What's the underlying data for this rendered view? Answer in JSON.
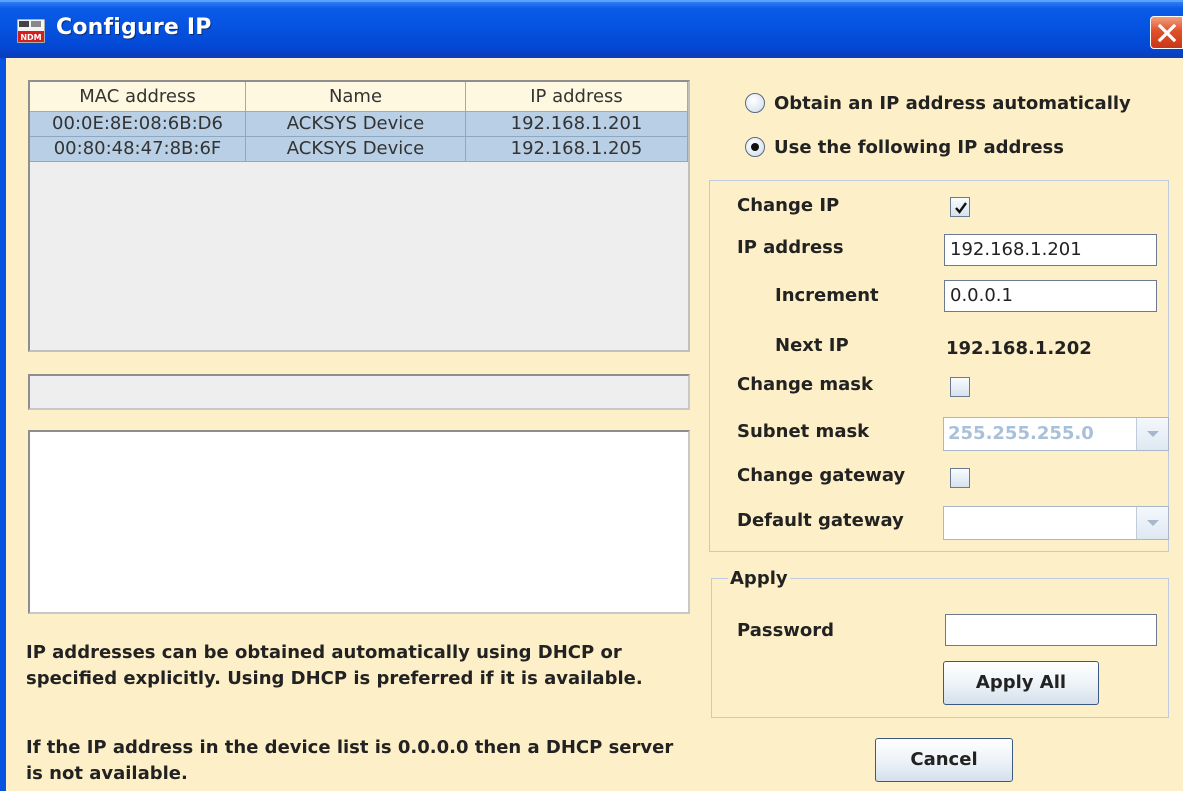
{
  "window": {
    "title": "Configure IP"
  },
  "table": {
    "headers": [
      "MAC address",
      "Name",
      "IP address"
    ],
    "rows": [
      [
        "00:0E:8E:08:6B:D6",
        "ACKSYS Device",
        "192.168.1.201"
      ],
      [
        "00:80:48:47:8B:6F",
        "ACKSYS Device",
        "192.168.1.205"
      ]
    ]
  },
  "help": {
    "dhcp_text": "IP addresses can be obtained automatically using DHCP or specified explicitly. Using DHCP is preferred if it is available.",
    "no_dhcp_text": "If the IP address in the device list is 0.0.0.0 then a DHCP server is not available."
  },
  "mode": {
    "auto_label": "Obtain an IP address automatically",
    "manual_label": "Use the following IP address",
    "selected": "manual"
  },
  "ip": {
    "change_ip_label": "Change IP",
    "change_ip_checked": true,
    "ip_address_label": "IP address",
    "ip_address_value": "192.168.1.201",
    "increment_label": "Increment",
    "increment_value": "0.0.0.1",
    "next_ip_label": "Next IP",
    "next_ip_value": "192.168.1.202",
    "change_mask_label": "Change mask",
    "change_mask_checked": false,
    "subnet_mask_label": "Subnet mask",
    "subnet_mask_value": "255.255.255.0",
    "change_gateway_label": "Change gateway",
    "change_gateway_checked": false,
    "default_gateway_label": "Default gateway",
    "default_gateway_value": ""
  },
  "apply": {
    "legend": "Apply",
    "password_label": "Password",
    "password_value": "",
    "apply_all_label": "Apply All"
  },
  "cancel_label": "Cancel",
  "colors": {
    "background": "#fdf0c8",
    "title_bar": "#0553e0",
    "selected_row": "#b8cfe5",
    "close_button": "#e0502a"
  },
  "icons": {
    "app": "ndm-app-icon",
    "close": "close-icon"
  }
}
